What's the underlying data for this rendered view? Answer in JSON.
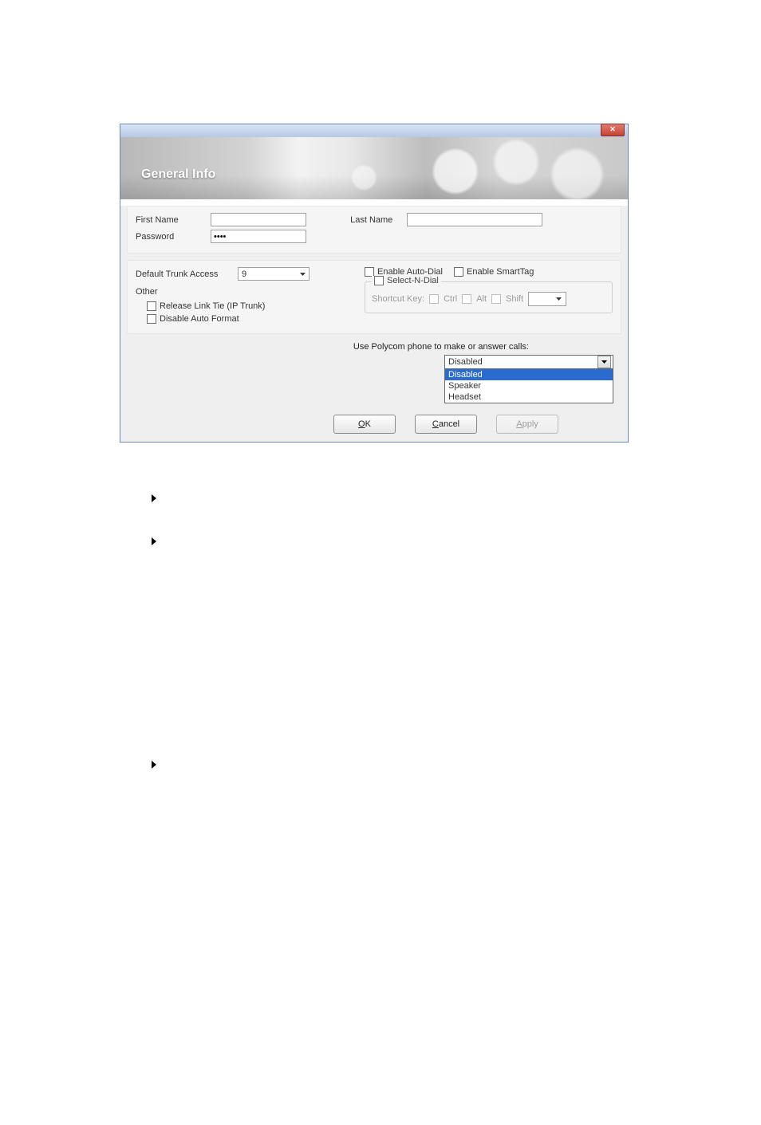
{
  "dialog": {
    "title": "General Info",
    "close_glyph": "✕"
  },
  "topPanel": {
    "firstNameLabel": "First Name",
    "firstNameValue": "",
    "lastNameLabel": "Last Name",
    "lastNameValue": "",
    "passwordLabel": "Password",
    "passwordValue": "••••"
  },
  "midPanel": {
    "trunkLabel": "Default Trunk Access",
    "trunkValue": "9",
    "otherLabel": "Other",
    "releaseLinkTie": "Release Link Tie (IP Trunk)",
    "disableAutoFormat": "Disable Auto Format",
    "enableAutoDial": "Enable Auto-Dial",
    "enableSmartTag": "Enable SmartTag",
    "selectNDial": "Select-N-Dial",
    "shortcutKey": "Shortcut Key:",
    "ctrl": "Ctrl",
    "alt": "Alt",
    "shift": "Shift"
  },
  "polycom": {
    "label": "Use Polycom phone to make or answer calls:",
    "selected": "Disabled",
    "options": [
      "Disabled",
      "Speaker",
      "Headset"
    ]
  },
  "buttons": {
    "ok": "OK",
    "ok_u": "O",
    "ok_rest": "K",
    "cancel": "Cancel",
    "cancel_u": "C",
    "cancel_rest": "ancel",
    "apply": "Apply",
    "apply_u": "A",
    "apply_rest": "pply"
  }
}
